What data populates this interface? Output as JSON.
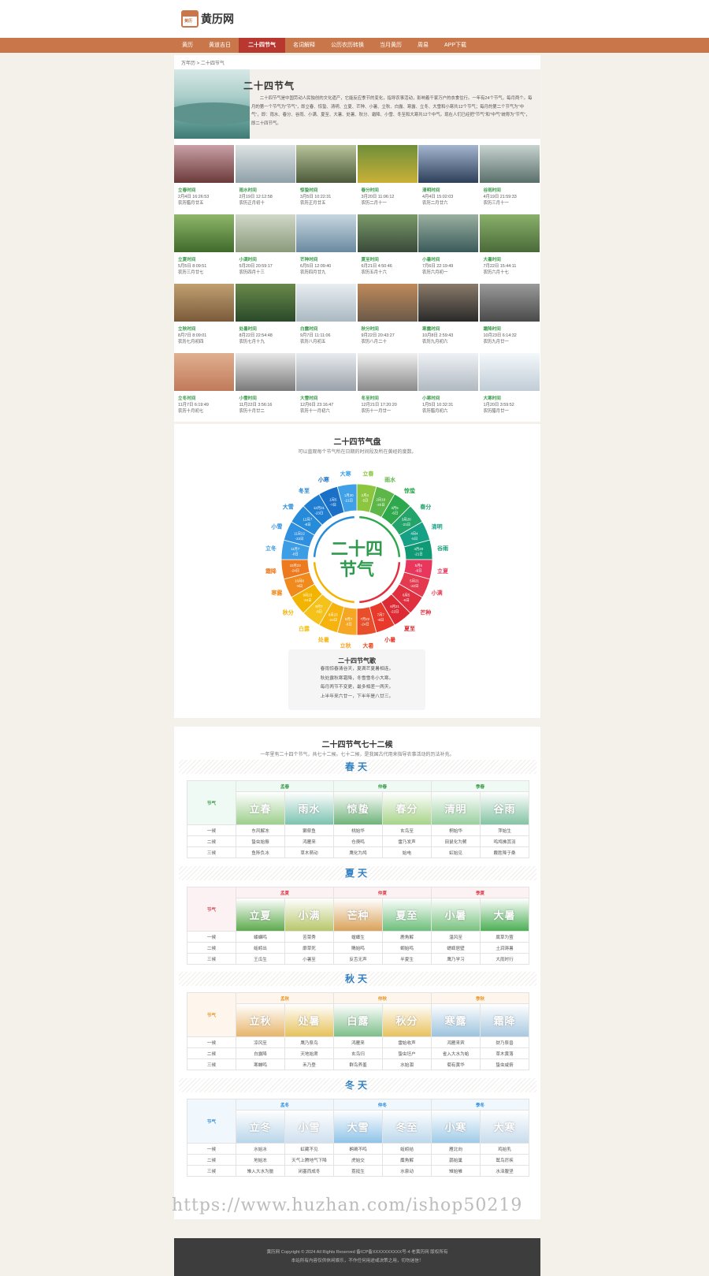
{
  "logo": {
    "name": "黄历网",
    "icon_text": "黄历"
  },
  "nav": [
    "黄历",
    "黄道吉日",
    "二十四节气",
    "名词解释",
    "公历农历转换",
    "当月黄历",
    "周易",
    "APP下载"
  ],
  "nav_active": 2,
  "breadcrumb": "万年历 > 二十四节气",
  "intro": {
    "title": "二十四节气",
    "text": "二十四节气是中国劳动人民独创的文化遗产，它能反应季节的变化，指导农事活动，影响着千家万户的衣食住行。一年有24个节气，每月两个。每月的第一个节气为\"节气\"，即立春、惊蛰、清明、立夏、芒种、小暑、立秋、白露、寒露、立冬、大雪和小寒共12个节气；每月的第二个节气为\"中气\"，即：雨水、春分、谷雨、小满、夏至、大暑、处暑、秋分、霜降、小雪、冬至和大寒共12个中气。现在人们已经把\"节气\"和\"中气\"统称为\"节气\"，即二十四节气。"
  },
  "cards": [
    {
      "name": "立春时间",
      "date": "2月4日 16:26:53",
      "lunar": "农历腊月廿五"
    },
    {
      "name": "雨水时间",
      "date": "2月19日 12:12:58",
      "lunar": "农历正月初十"
    },
    {
      "name": "惊蛰时间",
      "date": "3月5日 10:22:31",
      "lunar": "农历正月廿五"
    },
    {
      "name": "春分时间",
      "date": "3月20日 11:06:12",
      "lunar": "农历二月十一"
    },
    {
      "name": "清明时间",
      "date": "4月4日 15:02:03",
      "lunar": "农历二月廿六"
    },
    {
      "name": "谷雨时间",
      "date": "4月19日 21:59:33",
      "lunar": "农历三月十一"
    },
    {
      "name": "立夏时间",
      "date": "5月5日 8:09:51",
      "lunar": "农历三月廿七"
    },
    {
      "name": "小满时间",
      "date": "5月20日 20:59:17",
      "lunar": "农历四月十三"
    },
    {
      "name": "芒种时间",
      "date": "6月5日 12:09:40",
      "lunar": "农历四月廿九"
    },
    {
      "name": "夏至时间",
      "date": "6月21日 4:50:46",
      "lunar": "农历五月十六"
    },
    {
      "name": "小暑时间",
      "date": "7月6日 22:19:49",
      "lunar": "农历六月初一"
    },
    {
      "name": "大暑时间",
      "date": "7月22日 15:44:11",
      "lunar": "农历六月十七"
    },
    {
      "name": "立秋时间",
      "date": "8月7日 8:09:01",
      "lunar": "农历七月初四"
    },
    {
      "name": "处暑时间",
      "date": "8月22日 22:54:48",
      "lunar": "农历七月十九"
    },
    {
      "name": "白露时间",
      "date": "9月7日 11:11:06",
      "lunar": "农历八月初五"
    },
    {
      "name": "秋分时间",
      "date": "9月22日 20:43:27",
      "lunar": "农历八月二十"
    },
    {
      "name": "寒露时间",
      "date": "10月8日 2:59:43",
      "lunar": "农历九月初六"
    },
    {
      "name": "霜降时间",
      "date": "10月23日 6:14:32",
      "lunar": "农历九月廿一"
    },
    {
      "name": "立冬时间",
      "date": "11月7日 6:19:49",
      "lunar": "农历十月初七"
    },
    {
      "name": "小雪时间",
      "date": "11月22日 3:56:16",
      "lunar": "农历十月廿二"
    },
    {
      "name": "大雪时间",
      "date": "12月6日 23:16:47",
      "lunar": "农历十一月初六"
    },
    {
      "name": "冬至时间",
      "date": "12月21日 17:20:20",
      "lunar": "农历十一月廿一"
    },
    {
      "name": "小寒时间",
      "date": "1月5日 10:32:31",
      "lunar": "农历腊月初六"
    },
    {
      "name": "大寒时间",
      "date": "1月20日 3:59:52",
      "lunar": "农历腊月廿一"
    }
  ],
  "wheel": {
    "title": "二十四节气盘",
    "subtitle": "可以直观每个节气所在日期的时间段及所在黄经的度数。",
    "center_line1": "二十四",
    "center_line2": "节气",
    "terms": [
      "立春",
      "雨水",
      "惊蛰",
      "春分",
      "清明",
      "谷雨",
      "立夏",
      "小满",
      "芒种",
      "夏至",
      "小暑",
      "大暑",
      "立秋",
      "处暑",
      "白露",
      "秋分",
      "寒露",
      "霜降",
      "立冬",
      "小雪",
      "大雪",
      "冬至",
      "小寒",
      "大寒"
    ],
    "dates": [
      [
        "2月4",
        "-5日"
      ],
      [
        "2月19",
        "-20日"
      ],
      [
        "3月5",
        "-6日"
      ],
      [
        "3月20",
        "-21日"
      ],
      [
        "4月4",
        "-5日"
      ],
      [
        "4月20",
        "-21日"
      ],
      [
        "5月5",
        "-6日"
      ],
      [
        "5月21",
        "-22日"
      ],
      [
        "6月5",
        "-6日"
      ],
      [
        "6月21",
        "-22日"
      ],
      [
        "7月7",
        "-8日"
      ],
      [
        "7月22",
        "-24日"
      ],
      [
        "8月7",
        "-8日"
      ],
      [
        "8月23",
        "-24日"
      ],
      [
        "9月7",
        "-8日"
      ],
      [
        "9月23",
        "-24日"
      ],
      [
        "10月8",
        "-9日"
      ],
      [
        "10月23",
        "-24日"
      ],
      [
        "11月7",
        "-8日"
      ],
      [
        "11月22",
        "-23日"
      ],
      [
        "12月7",
        "-8日"
      ],
      [
        "12月21",
        "-23日"
      ],
      [
        "1月5",
        "-7日"
      ],
      [
        "1月20",
        "-21日"
      ]
    ],
    "colors": [
      "#8cc63f",
      "#5db648",
      "#2ea84d",
      "#23a46b",
      "#16a085",
      "#0f9a75",
      "#e8365d",
      "#e33a4f",
      "#e0303f",
      "#dc2b34",
      "#e8392b",
      "#e84e2a",
      "#f5a623",
      "#f6b30d",
      "#f4c21a",
      "#f2b400",
      "#f08a1d",
      "#ee7a20",
      "#3d9ee6",
      "#2f8fe0",
      "#268bd8",
      "#1f7ed1",
      "#1a6fc6",
      "#3fa0e8"
    ],
    "song_title": "二十四节气歌",
    "song": [
      "春雨惊春清谷天，夏满芒夏暑相连。",
      "秋处露秋寒霜降，冬雪雪冬小大寒。",
      "每月两节不变更，最多相差一两天。",
      "上半年来六廿一，下半年是八廿三。"
    ]
  },
  "seventy_two": {
    "title": "二十四节气七十二候",
    "subtitle": "一年里有二十四个节气，共七十二候。七十二候，是我国古代用来指导农事活动的历法补充。",
    "label_term": "节气",
    "label_h1": "一候",
    "label_h2": "二候",
    "label_h3": "三候",
    "seasons": [
      {
        "name": "春天",
        "color": "#2f7fc1",
        "accent": "#3a9a4a",
        "bg": "#eefaf3",
        "months": [
          "孟春",
          "仲春",
          "季春"
        ],
        "terms": [
          "立春",
          "雨水",
          "惊蛰",
          "春分",
          "清明",
          "谷雨"
        ],
        "h1": [
          "东风解冻",
          "獭祭鱼",
          "桃始华",
          "玄鸟至",
          "桐始华",
          "萍始生"
        ],
        "h2": [
          "蛰虫始振",
          "鸿雁来",
          "仓庚鸣",
          "雷乃发声",
          "田鼠化为鴽",
          "鸣鸠拂其羽"
        ],
        "h3": [
          "鱼陟负冰",
          "草木萌动",
          "鹰化为鸠",
          "始电",
          "虹始见",
          "戴胜降于桑"
        ],
        "term_colors": [
          "#9ccf8c",
          "#7cc3b0",
          "#6fb37a",
          "#a8d48a",
          "#9ad0a0",
          "#84c4a4"
        ]
      },
      {
        "name": "夏天",
        "color": "#2f7fc1",
        "accent": "#d9434f",
        "bg": "#fdf2f3",
        "months": [
          "孟夏",
          "仲夏",
          "季夏"
        ],
        "terms": [
          "立夏",
          "小满",
          "芒种",
          "夏至",
          "小暑",
          "大暑"
        ],
        "h1": [
          "蝼蝈鸣",
          "苦菜秀",
          "螳螂生",
          "鹿角解",
          "温风至",
          "腐草为萤"
        ],
        "h2": [
          "蚯蚓出",
          "靡草死",
          "鵙始鸣",
          "蜩始鸣",
          "蟋蟀居壁",
          "土润溽暑"
        ],
        "h3": [
          "王瓜生",
          "小暑至",
          "反舌无声",
          "半夏生",
          "鹰乃学习",
          "大雨时行"
        ],
        "term_colors": [
          "#5caa4c",
          "#b8c76a",
          "#d9a25a",
          "#6cbf7a",
          "#78c27e",
          "#4caf55"
        ]
      },
      {
        "name": "秋天",
        "color": "#2f7fc1",
        "accent": "#e9962a",
        "bg": "#fef6ed",
        "months": [
          "孟秋",
          "仲秋",
          "季秋"
        ],
        "terms": [
          "立秋",
          "处暑",
          "白露",
          "秋分",
          "寒露",
          "霜降"
        ],
        "h1": [
          "凉风至",
          "鹰乃祭鸟",
          "鸿雁来",
          "雷始收声",
          "鸿雁来宾",
          "豺乃祭兽"
        ],
        "h2": [
          "白露降",
          "天地始肃",
          "玄鸟归",
          "蛰虫坯户",
          "雀入大水为蛤",
          "草木黄落"
        ],
        "h3": [
          "寒蝉鸣",
          "禾乃登",
          "群鸟养羞",
          "水始涸",
          "菊有黄华",
          "蛰虫咸俯"
        ],
        "term_colors": [
          "#e7b56a",
          "#e6c25a",
          "#7dbf8a",
          "#e8c25e",
          "#9cc3de",
          "#a8c8e0"
        ]
      },
      {
        "name": "冬天",
        "color": "#2f7fc1",
        "accent": "#2f8fe0",
        "bg": "#f0f7fd",
        "months": [
          "孟冬",
          "仲冬",
          "季冬"
        ],
        "terms": [
          "立冬",
          "小雪",
          "大雪",
          "冬至",
          "小寒",
          "大寒"
        ],
        "h1": [
          "水始冰",
          "虹藏不见",
          "鹖鴠不鸣",
          "蚯蚓结",
          "雁北向",
          "鸡始乳"
        ],
        "h2": [
          "地始冻",
          "天气上腾地气下降",
          "虎始交",
          "麋角解",
          "鹊始巢",
          "鹫鸟厉疾"
        ],
        "h3": [
          "雉入大水为蜃",
          "闭塞而成冬",
          "荔挺生",
          "水泉动",
          "雉始雊",
          "水泽腹坚"
        ],
        "term_colors": [
          "#b9d6ea",
          "#cfe0ee",
          "#8ec3e8",
          "#bcd8ec",
          "#9fcbe8",
          "#c8dcec"
        ]
      }
    ]
  },
  "footer": {
    "line1": "黄历网   Copyright © 2024 All Rights Reserved   备ICP备XXXXXXXXXX号-4   老黄历网   版权所有",
    "line2": "本站所有内容仅供休闲娱乐，不作任何用途或决策之用，切勿迷信！"
  },
  "watermark": "https://www.huzhan.com/ishop50219"
}
